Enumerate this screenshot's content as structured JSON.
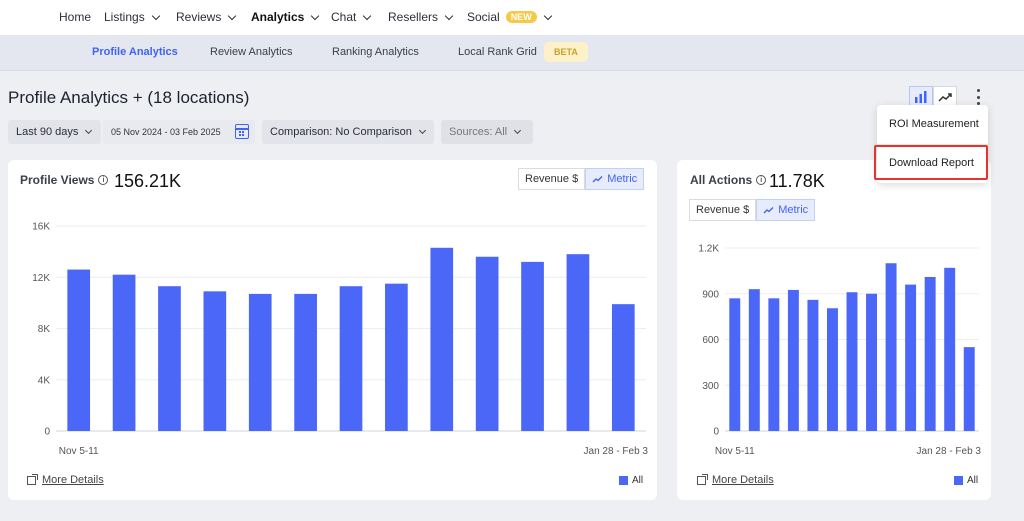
{
  "nav": {
    "items": [
      {
        "label": "Home",
        "dropdown": false,
        "active": false
      },
      {
        "label": "Listings",
        "dropdown": true,
        "active": false
      },
      {
        "label": "Reviews",
        "dropdown": true,
        "active": false
      },
      {
        "label": "Analytics",
        "dropdown": true,
        "active": true
      },
      {
        "label": "Chat",
        "dropdown": true,
        "active": false
      },
      {
        "label": "Resellers",
        "dropdown": true,
        "active": false
      },
      {
        "label": "Social",
        "dropdown": true,
        "active": false
      }
    ],
    "social_badge": "NEW"
  },
  "subnav": {
    "items": [
      "Profile Analytics",
      "Review Analytics",
      "Ranking Analytics",
      "Local Rank Grid"
    ],
    "active": "Profile Analytics",
    "beta_badge": "BETA"
  },
  "page": {
    "title": "Profile Analytics + (18 locations)"
  },
  "filters": {
    "period": "Last 90 days",
    "date_range": "05 Nov 2024 - 03 Feb 2025",
    "comparison": "Comparison: No Comparison",
    "sources": "Sources: All"
  },
  "menu": {
    "items": [
      "ROI Measurement",
      "Download Report"
    ],
    "highlighted": "Download Report"
  },
  "segment": {
    "revenue_label": "Revenue $",
    "metric_label": "Metric"
  },
  "cards": {
    "profile_views": {
      "title": "Profile Views",
      "value": "156.21K",
      "more_details": "More Details",
      "legend": "All"
    },
    "all_actions": {
      "title": "All Actions",
      "value": "11.78K",
      "more_details": "More Details",
      "legend": "All"
    }
  },
  "colors": {
    "accent": "#3e63f5",
    "bar": "#4a67f7",
    "highlight_border": "#e0362c",
    "beta_bg": "#fdf1c9"
  },
  "chart_data": [
    {
      "type": "bar",
      "title": "Profile Views",
      "x_first_label": "Nov 5-11",
      "x_last_label": "Jan 28 - Feb 3",
      "ytick_labels": [
        "0",
        "4K",
        "8K",
        "12K",
        "16K"
      ],
      "ylim": [
        0,
        16000
      ],
      "grid": true,
      "legend": "bottom-right",
      "series": [
        {
          "name": "All",
          "values": [
            12600,
            12200,
            11300,
            10900,
            10700,
            10700,
            11300,
            11500,
            14300,
            13600,
            13200,
            13800,
            9900
          ]
        }
      ]
    },
    {
      "type": "bar",
      "title": "All Actions",
      "x_first_label": "Nov 5-11",
      "x_last_label": "Jan 28 - Feb 3",
      "ytick_labels": [
        "0",
        "300",
        "600",
        "900",
        "1.2K"
      ],
      "ylim": [
        0,
        1200
      ],
      "grid": true,
      "legend": "bottom-right",
      "series": [
        {
          "name": "All",
          "values": [
            870,
            930,
            870,
            925,
            860,
            805,
            910,
            900,
            1100,
            960,
            1010,
            1070,
            550
          ]
        }
      ]
    }
  ]
}
